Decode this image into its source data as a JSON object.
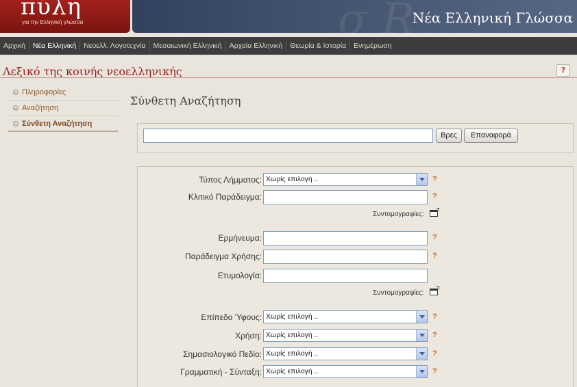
{
  "header": {
    "logo_text": "πύλη",
    "logo_subtitle": "για την Ελληνική γλώσσα",
    "banner_title": "Νέα Ελληνική Γλώσσα",
    "banner_watermark": "σ R"
  },
  "nav": {
    "items": [
      {
        "label": "Αρχική"
      },
      {
        "label": "Νέα Ελληνική"
      },
      {
        "label": "Νεοελλ. Λογοτεχνία"
      },
      {
        "label": "Μεσαιωνική Ελληνική"
      },
      {
        "label": "Αρχαία Ελληνική"
      },
      {
        "label": "Θεωρία & Ιστορία"
      },
      {
        "label": "Ενημέρωση"
      }
    ],
    "active_index": 1
  },
  "dictionary": {
    "title": "Λεξικό της κοινής νεοελληνικής",
    "help_label": "?"
  },
  "sidebar": {
    "items": [
      {
        "label": "Πληροφορίες"
      },
      {
        "label": "Αναζήτηση"
      },
      {
        "label": "Σύνθετη Αναζήτηση"
      }
    ],
    "active_index": 2
  },
  "main": {
    "title": "Σύνθετη Αναζήτηση",
    "search": {
      "value": "",
      "find_label": "Βρες",
      "reset_label": "Επαναφορά"
    },
    "form": {
      "entry_type": {
        "label": "Τύπος Λήμματος:",
        "value": "Χωρίς επιλογή .."
      },
      "inflection_example": {
        "label": "Κλιτικό Παράδειγμα:",
        "value": ""
      },
      "abbreviations_1": "Συντομογραφίες:",
      "meaning": {
        "label": "Ερμήνευμα:",
        "value": ""
      },
      "usage_example": {
        "label": "Παράδειγμα Χρήσης:",
        "value": ""
      },
      "etymology": {
        "label": "Ετυμολογία:",
        "value": ""
      },
      "abbreviations_2": "Συντομογραφίες:",
      "style_level": {
        "label": "Επίπεδο Ύφους:",
        "value": "Χωρίς επιλογή .."
      },
      "usage": {
        "label": "Χρήση:",
        "value": "Χωρίς επιλογή .."
      },
      "semantic_field": {
        "label": "Σημασιολογικό Πεδίο:",
        "value": "Χωρίς επιλογή .."
      },
      "grammar_syntax": {
        "label": "Γραμματική - Σύνταξη:",
        "value": "Χωρίς επιλογή .."
      },
      "help_mark": "?"
    }
  },
  "colors": {
    "brand_red": "#9b1a1a",
    "nav_bg": "#3d3d3d",
    "page_bg": "#e9e5dc",
    "help_orange": "#d2691e"
  }
}
